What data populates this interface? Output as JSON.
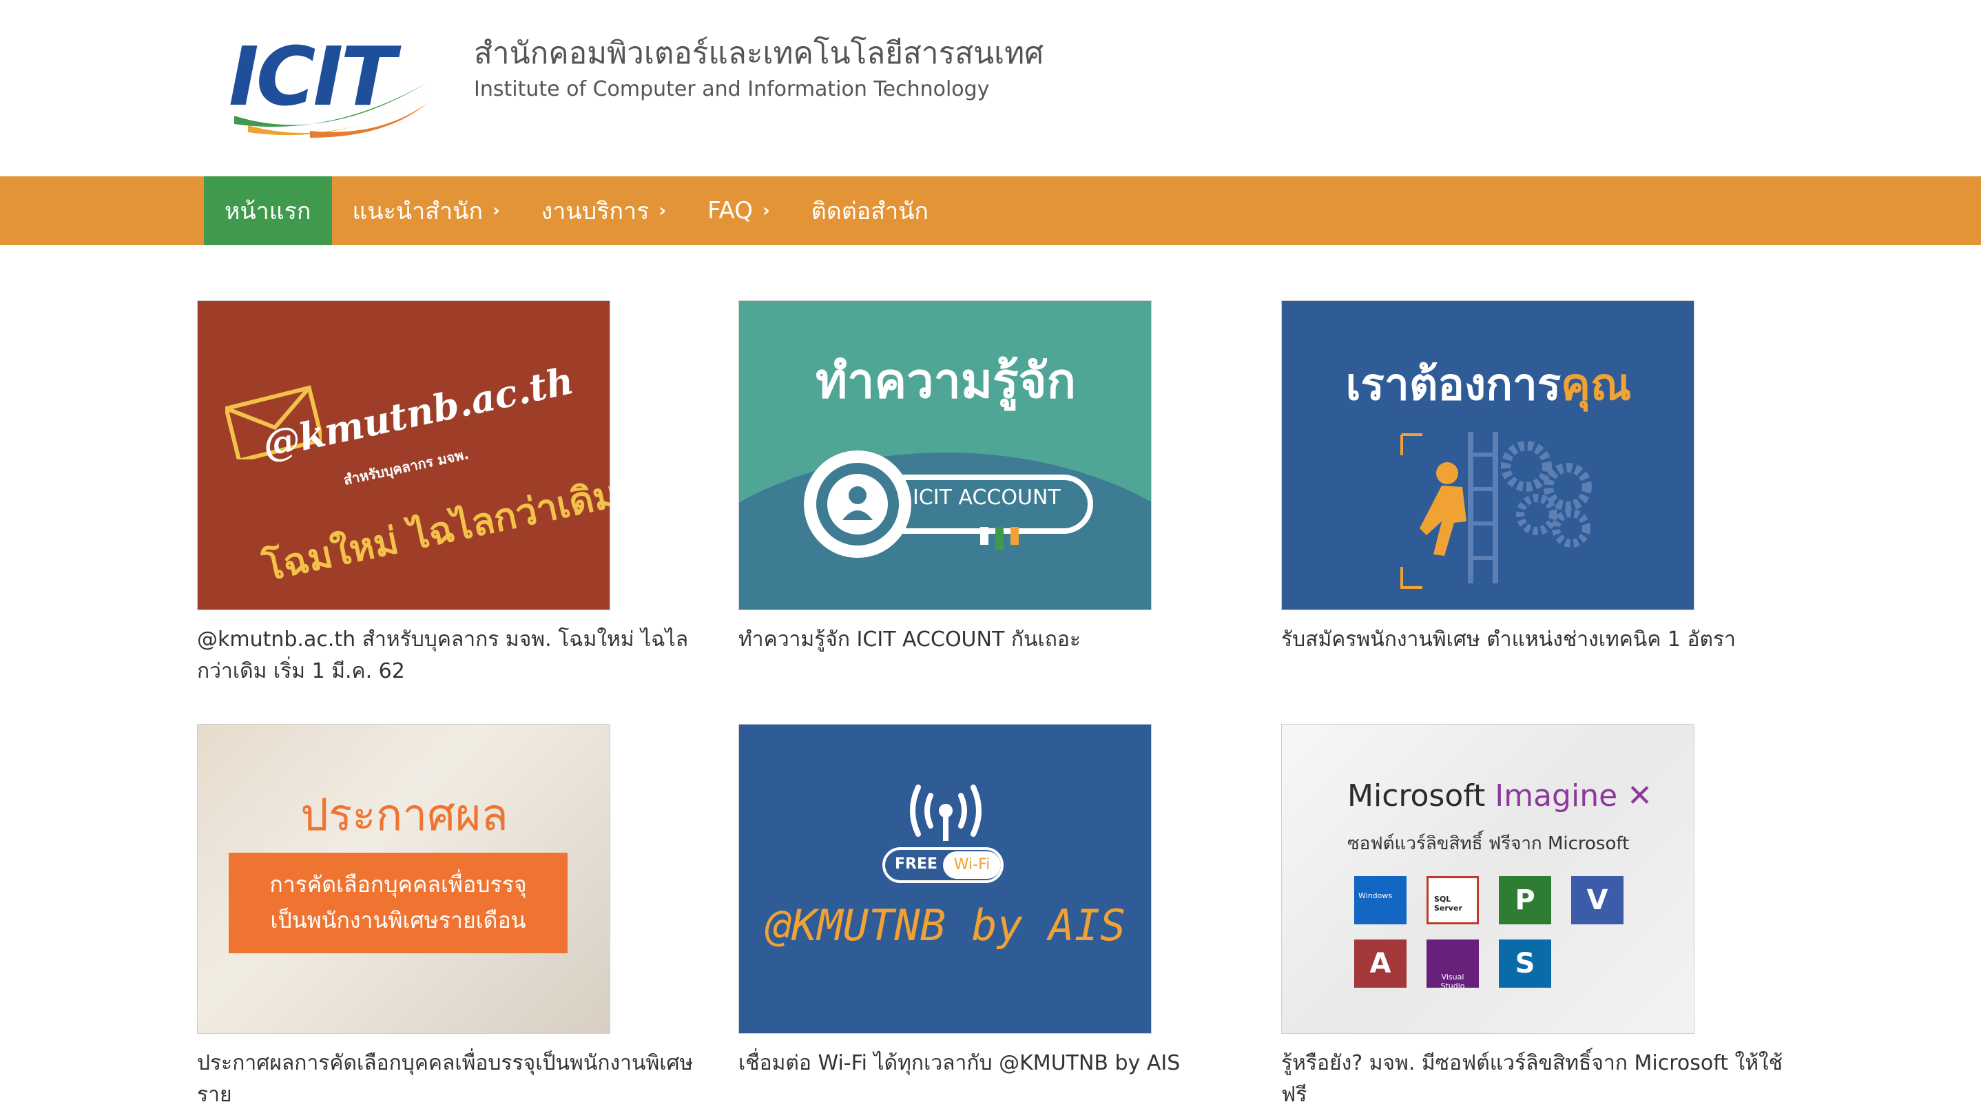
{
  "header": {
    "logo_text": "ICIT",
    "title_th": "สำนักคอมพิวเตอร์และเทคโนโลยีสารสนเทศ",
    "title_en": "Institute of Computer and Information Technology"
  },
  "nav": {
    "items": [
      {
        "label": "หน้าแรก",
        "active": true,
        "has_submenu": false
      },
      {
        "label": "แนะนำสำนัก",
        "active": false,
        "has_submenu": true
      },
      {
        "label": "งานบริการ",
        "active": false,
        "has_submenu": true
      },
      {
        "label": "FAQ",
        "active": false,
        "has_submenu": true
      },
      {
        "label": "ติดต่อสำนัก",
        "active": false,
        "has_submenu": false
      }
    ]
  },
  "cards": [
    {
      "caption": "@kmutnb.ac.th สำหรับบุคลากร มจพ. โฉมใหม่ ไฉไลกว่าเดิม เริ่ม 1 มี.ค. 62",
      "image": {
        "email": "@kmutnb.ac.th",
        "sub": "สำหรับบุคลากร มจพ.",
        "tagline": "โฉมใหม่ ไฉไลกว่าเดิม"
      }
    },
    {
      "caption": "ทำความรู้จัก ICIT ACCOUNT กันเถอะ",
      "image": {
        "headline": "ทำความรู้จัก",
        "key_label": "ICIT ACCOUNT"
      }
    },
    {
      "caption": "รับสมัครพนักงานพิเศษ ตำแหน่งช่างเทคนิค 1 อัตรา",
      "image": {
        "headline_main": "เราต้องการ",
        "headline_accent": "คุณ"
      }
    },
    {
      "caption": "ประกาศผลการคัดเลือกบุคคลเพื่อบรรจุเป็นพนักงานพิเศษราย",
      "image": {
        "headline": "ประกาศผล",
        "box_line1": "การคัดเลือกบุคคลเพื่อบรรจุ",
        "box_line2": "เป็นพนักงานพิเศษรายเดือน"
      }
    },
    {
      "caption": "เชื่อมต่อ Wi-Fi ได้ทุกเวลากับ @KMUTNB by AIS",
      "image": {
        "badge_free": "FREE",
        "badge_wifi": "Wi-Fi",
        "text": "@KMUTNB by AIS"
      }
    },
    {
      "caption": "รู้หรือยัง? มจพ. มีซอฟต์แวร์ลิขสิทธิ์จาก Microsoft ให้ใช้ฟรี",
      "image": {
        "brand": "Microsoft",
        "product": "Imagine",
        "sub": "ซอฟต์แวร์ลิขสิทธิ์ ฟรีจาก Microsoft",
        "apps": [
          "Windows",
          "SQL Server",
          "P",
          "V",
          "A",
          "Visual Studio",
          "S"
        ]
      }
    }
  ],
  "colors": {
    "nav_bg": "#e39436",
    "nav_active": "#3f9a4d",
    "logo_blue": "#1f4e9a"
  }
}
